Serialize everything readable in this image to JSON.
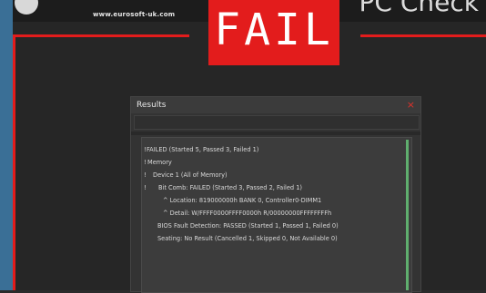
{
  "header": {
    "site_url": "www.eurosoft-uk.com",
    "brand_fragment": "PC Check"
  },
  "banner": {
    "status_text": "FAIL"
  },
  "dialog": {
    "title": "Results",
    "close_glyph": "×",
    "lines": [
      {
        "marker": "!",
        "text": "FAILED (Started 5, Passed 3, Failed 1)"
      },
      {
        "marker": "!",
        "text": "Memory"
      },
      {
        "marker": "!",
        "text": "Device 1 (All of Memory)"
      },
      {
        "marker": "!",
        "text": "Bit Comb: FAILED (Started 3, Passed 2, Failed 1)"
      },
      {
        "marker": "",
        "text": "^ Location: 819000000h BANK 0, Controller0-DIMM1"
      },
      {
        "marker": "",
        "text": "^ Detail: W/FFFF0000FFFF0000h R/00000000FFFFFFFFh"
      },
      {
        "marker": "",
        "text": "BIOS Fault Detection: PASSED (Started 1, Passed 1, Failed 0)"
      },
      {
        "marker": "",
        "text": "Seating: No Result (Cancelled 1, Skipped 0, Not Available 0)"
      }
    ]
  },
  "colors": {
    "accent_red": "#e31c1c",
    "frame_blue": "#3a6f96",
    "scroll_green": "#5fae6e"
  }
}
